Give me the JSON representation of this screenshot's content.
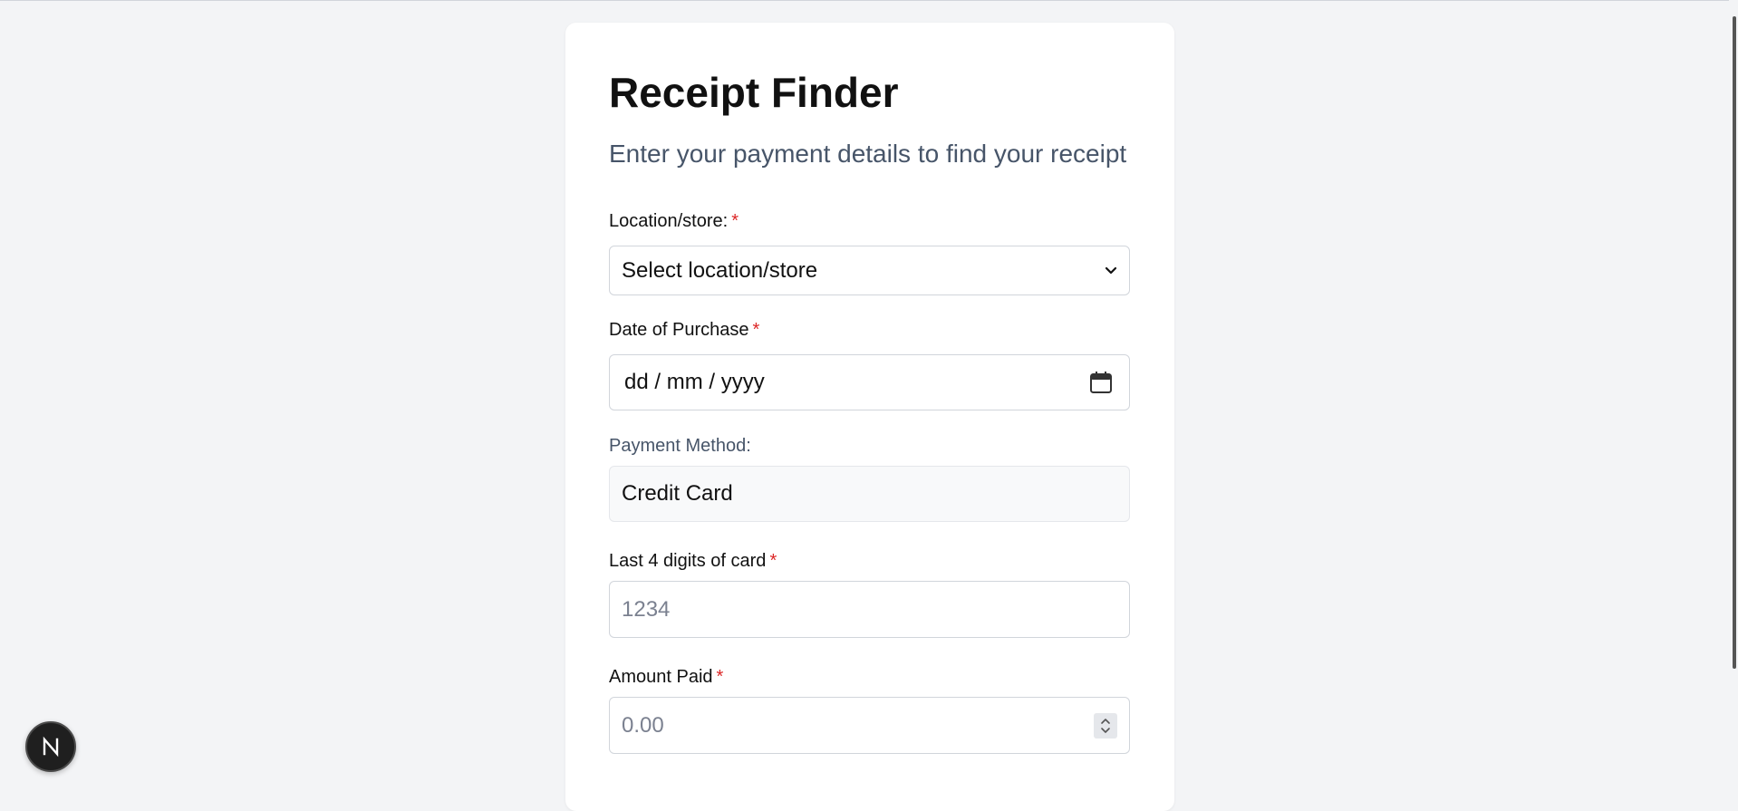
{
  "page": {
    "title": "Receipt Finder",
    "subtitle": "Enter your payment details to find your receipt"
  },
  "form": {
    "location": {
      "label": "Location/store:",
      "required_mark": "*",
      "selected": "Select location/store"
    },
    "date": {
      "label": "Date of Purchase",
      "required_mark": "*",
      "value": "dd / mm / yyyy"
    },
    "payment_method": {
      "label": "Payment Method:",
      "value": "Credit Card"
    },
    "last4": {
      "label": "Last 4 digits of card",
      "required_mark": "*",
      "placeholder": "1234"
    },
    "amount": {
      "label": "Amount Paid",
      "required_mark": "*",
      "placeholder": "0.00"
    }
  },
  "fab": {
    "letter": "N"
  },
  "colors": {
    "background": "#f3f4f6",
    "card": "#ffffff",
    "required": "#dc2626",
    "subtitle": "#475569"
  },
  "icons": {
    "select": "chevron-down-icon",
    "date": "calendar-icon",
    "amount": "number-spinner-icon"
  }
}
